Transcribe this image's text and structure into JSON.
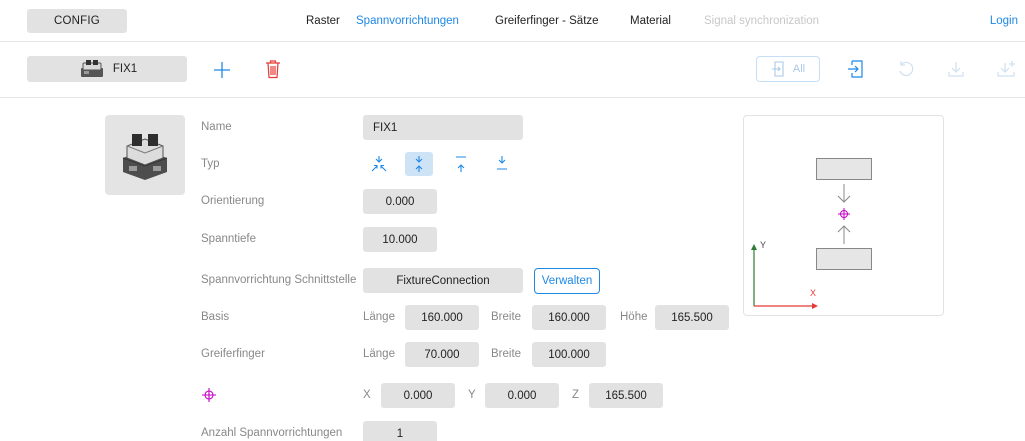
{
  "topbar": {
    "config_label": "CONFIG",
    "nav": [
      {
        "label": "Raster",
        "state": "normal"
      },
      {
        "label": "Spannvorrichtungen",
        "state": "active"
      },
      {
        "label": "Greiferfinger - Sätze",
        "state": "normal"
      },
      {
        "label": "Material",
        "state": "normal"
      },
      {
        "label": "Signal synchronization",
        "state": "disabled"
      }
    ],
    "login_label": "Login"
  },
  "toolbar": {
    "fixture_name": "FIX1",
    "add_icon": "plus-icon",
    "delete_icon": "trash-icon",
    "all_label": "All",
    "icons": [
      "export-all-icon",
      "export-icon",
      "reset-icon",
      "download-icon",
      "download-plus-icon"
    ]
  },
  "form": {
    "name_label": "Name",
    "name_value": "FIX1",
    "typ_label": "Typ",
    "typ_options": [
      "inward-clamp-icon",
      "center-clamp-icon",
      "outward-clamp-icon",
      "single-clamp-icon"
    ],
    "typ_selected_index": 1,
    "orientierung_label": "Orientierung",
    "orientierung_value": "0.000",
    "spanntiefe_label": "Spanntiefe",
    "spanntiefe_value": "10.000",
    "schnittstelle_label": "Spannvorrichtung Schnittstelle",
    "schnittstelle_value": "FixtureConnection",
    "verwalten_label": "Verwalten",
    "basis_label": "Basis",
    "basis": {
      "laenge_label": "Länge",
      "laenge": "160.000",
      "breite_label": "Breite",
      "breite": "160.000",
      "hoehe_label": "Höhe",
      "hoehe": "165.500"
    },
    "greiferfinger_label": "Greiferfinger",
    "greiferfinger": {
      "laenge_label": "Länge",
      "laenge": "70.000",
      "breite_label": "Breite",
      "breite": "100.000"
    },
    "origin_icon": "crosshair-icon",
    "origin": {
      "x_label": "X",
      "x": "0.000",
      "y_label": "Y",
      "y": "0.000",
      "z_label": "Z",
      "z": "165.500"
    },
    "anzahl_label": "Anzahl Spannvorrichtungen",
    "anzahl_value": "1"
  },
  "preview": {
    "x_axis_label": "X",
    "y_axis_label": "Y",
    "axis_color": "#e53935",
    "y_axis_color": "#2e7d32",
    "marker_color": "#c400c4"
  },
  "colors": {
    "accent": "#1e88e5",
    "field_bg": "#e2e2e2",
    "marker": "#c400c4"
  }
}
